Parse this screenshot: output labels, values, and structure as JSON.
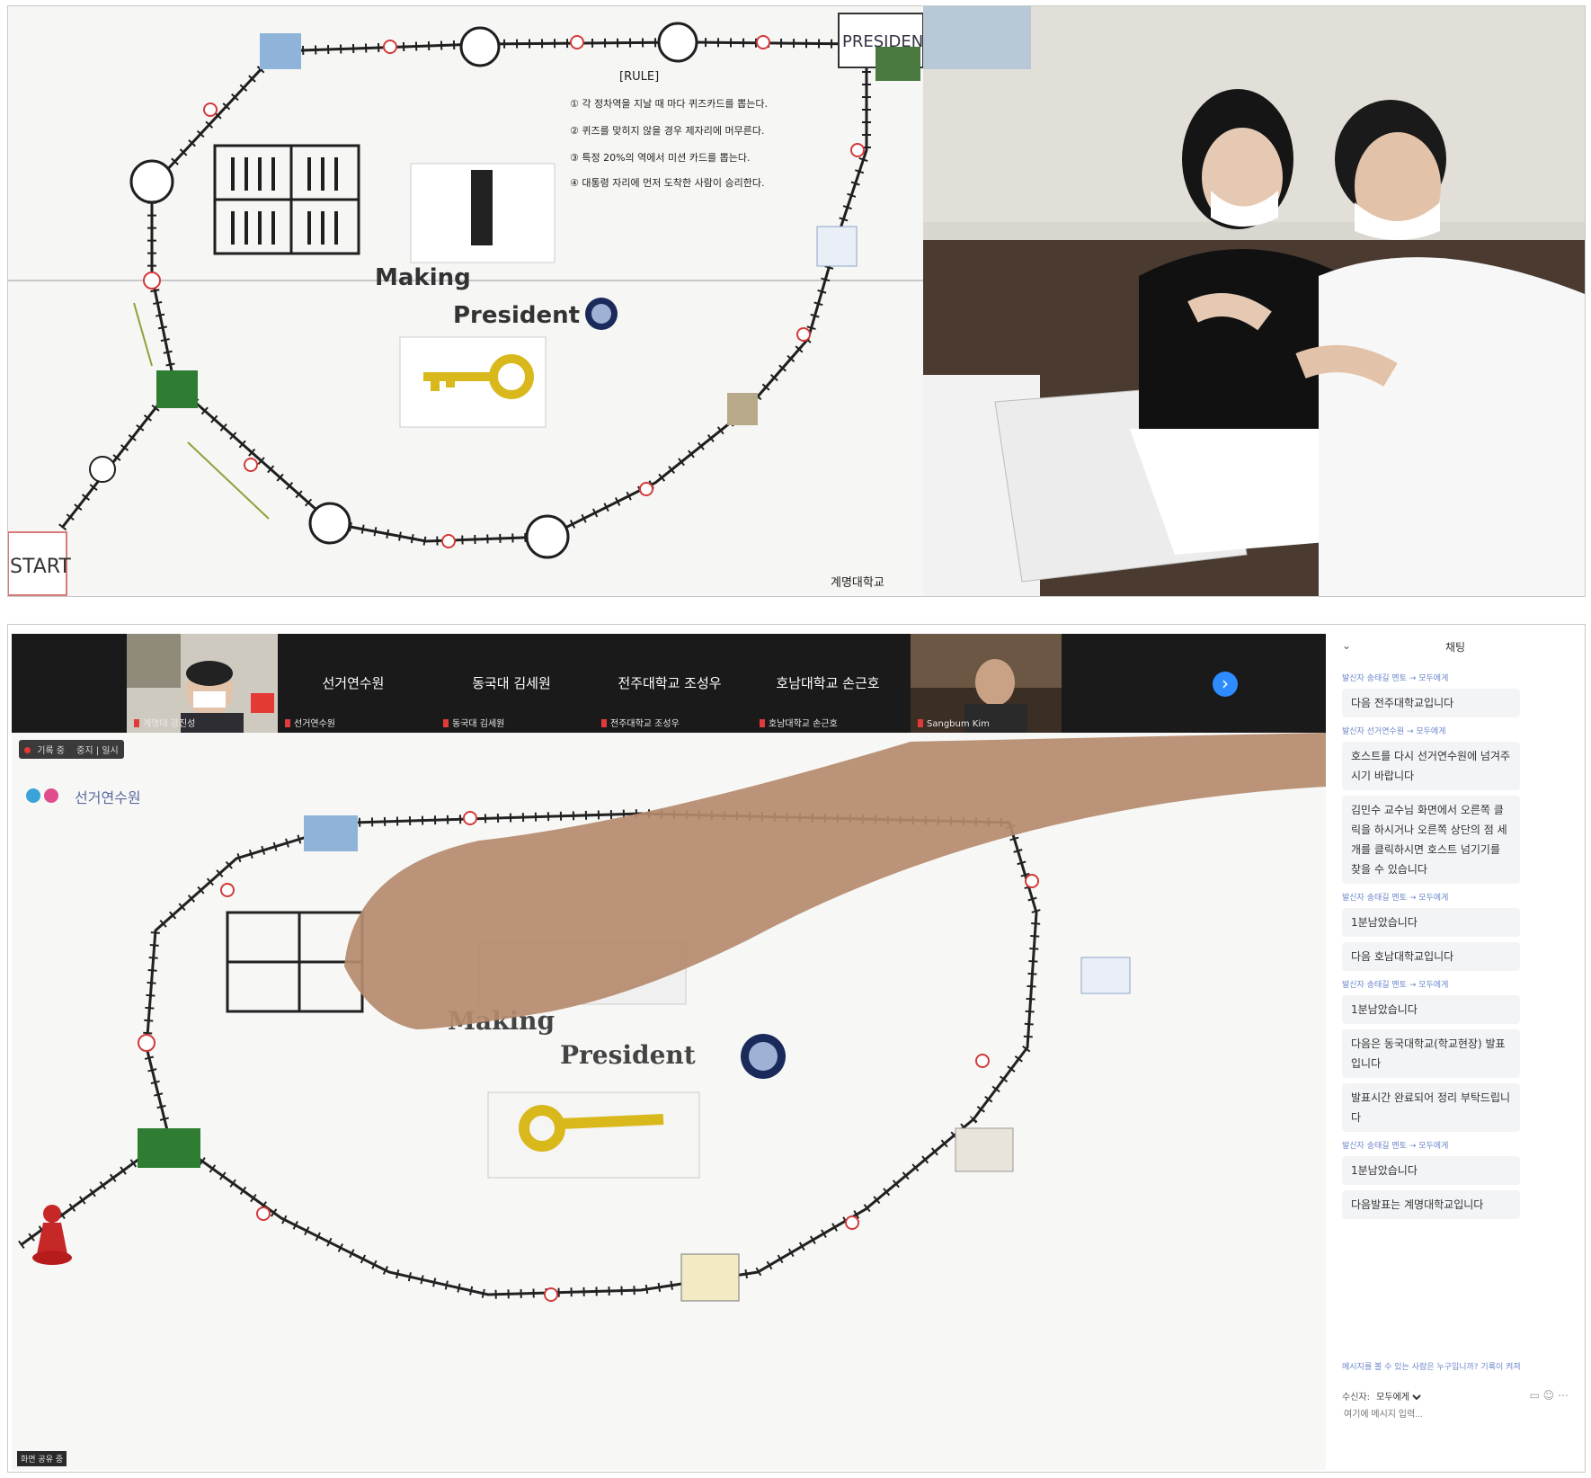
{
  "board": {
    "title_line1": "Making",
    "title_line2": "President",
    "rule_title": "[RULE]",
    "rules": [
      "① 각 정차역을 지날 때 마다 퀴즈카드를 뽑는다.",
      "② 퀴즈를 맞히지 않을 경우 제자리에 머무른다.",
      "③ 특정 20%의 역에서 미션 카드를 뽑는다.",
      "④ 대통령 자리에 먼저 도착한 사람이 승리한다."
    ],
    "start_label": "START",
    "president_label": "PRESIDENT",
    "footer": "계명대학교"
  },
  "zoom": {
    "participants": [
      {
        "label": "계명대 강진성",
        "name": ""
      },
      {
        "label": "선거연수원",
        "name": "선거연수원"
      },
      {
        "label": "동국대 김세원",
        "name": "동국대 김세원"
      },
      {
        "label": "전주대학교 조성우",
        "name": "전주대학교 조성우"
      },
      {
        "label": "호남대학교 손근호",
        "name": "호남대학교 손근호"
      },
      {
        "label": "Sangbum Kim",
        "name": ""
      }
    ],
    "recording_label": "기록 중",
    "recording_button": "중지 | 일시",
    "share_tag": "화면 공유 중",
    "board_logo": "선거연수원"
  },
  "chat": {
    "title": "채팅",
    "collapse": "⌄",
    "items": [
      {
        "meta": "발신자 송태길 멘토 → 모두에게",
        "texts": [
          "다음 전주대학교입니다"
        ]
      },
      {
        "meta": "발신자 선거연수원 → 모두에게",
        "texts": [
          "호스트를 다시 선거연수원에 넘겨주시기 바랍니다",
          "김민수 교수님 화면에서 오른쪽 클릭을 하시거나 오른쪽 상단의 점 세개를 클릭하시면 호스트 넘기기를 찾을 수 있습니다"
        ]
      },
      {
        "meta": "발신자 송태길 멘토 → 모두에게",
        "texts": [
          "1분남았습니다",
          "다음 호남대학교입니다"
        ]
      },
      {
        "meta": "발신자 송태길 멘토 → 모두에게",
        "texts": [
          "1분남았습니다",
          "다음은 동국대학교(학교현장) 발표입니다",
          "발표시간 완료되어 정리 부탁드립니다"
        ]
      },
      {
        "meta": "발신자 송태길 멘토 → 모두에게",
        "texts": [
          "1분남았습니다",
          "다음발표는 계명대학교입니다"
        ]
      }
    ],
    "hint": "메시지를 볼 수 있는 사람은 누구입니까? 기록이 켜져",
    "to_label": "수신자:",
    "to_value": "모두에게",
    "input_placeholder": "여기에 메시지 입력..."
  },
  "colors": {
    "accent": "#2d8cff",
    "record": "#e53935",
    "key": "#d9b81c",
    "track": "#222222"
  }
}
